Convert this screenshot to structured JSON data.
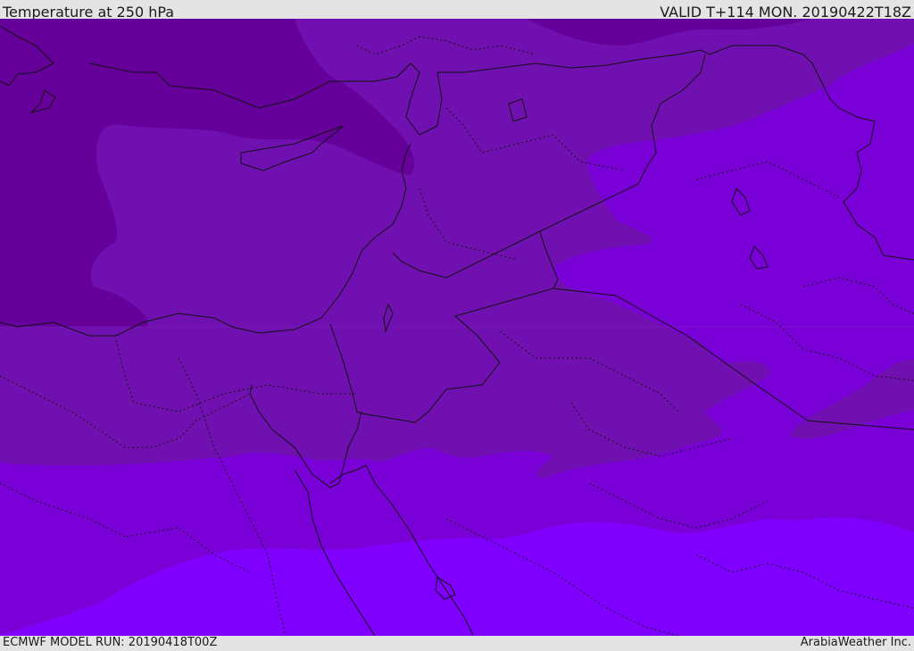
{
  "header": {
    "title": "Temperature at 250 hPa",
    "valid_time": "VALID T+114 MON. 20190422T18Z"
  },
  "footer": {
    "model_run": "ECMWF MODEL RUN: 20190418T00Z",
    "credit": "ArabiaWeather Inc."
  },
  "map": {
    "field": "temperature",
    "pressure_level": "250 hPa",
    "band_colors": [
      "#65009a",
      "#7010b0",
      "#7a00d8",
      "#7f00ff"
    ],
    "boundary_color": "#111111",
    "coastline_color": "#111111"
  }
}
